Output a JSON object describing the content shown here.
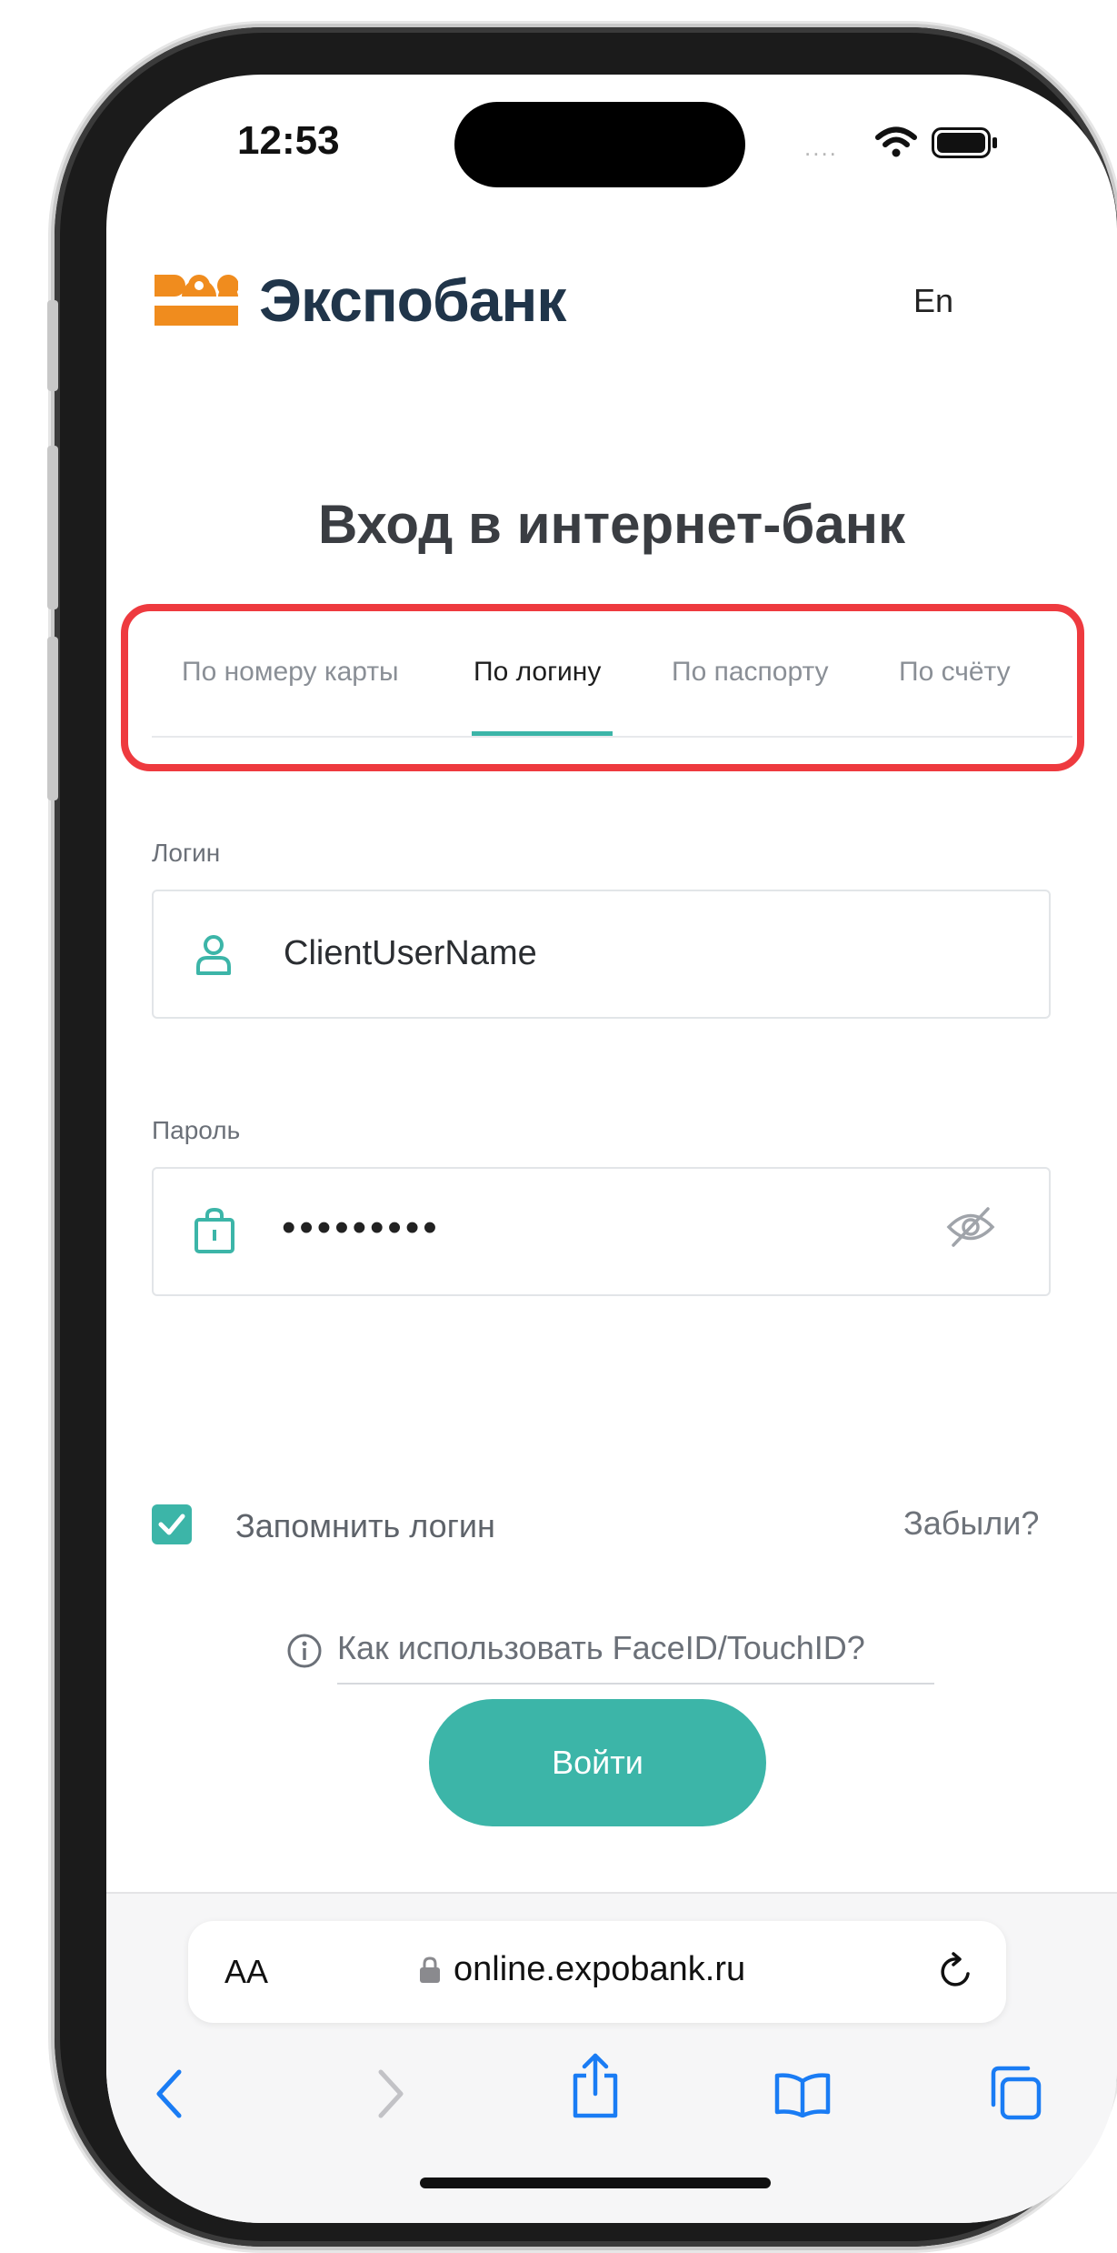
{
  "status_bar": {
    "time": "12:53",
    "signal_dots": "....",
    "icons": [
      "wifi-icon",
      "battery-icon"
    ]
  },
  "header": {
    "logo_text": "Экспобанк",
    "language": "En"
  },
  "title": "Вход в интернет-банк",
  "tabs": [
    {
      "label": "По номеру карты",
      "active": false
    },
    {
      "label": "По логину",
      "active": true
    },
    {
      "label": "По паспорту",
      "active": false
    },
    {
      "label": "По счёту",
      "active": false
    }
  ],
  "login_field": {
    "label": "Логин",
    "value": "ClientUserName",
    "icon": "user-icon"
  },
  "password_field": {
    "label": "Пароль",
    "value": "•••••••••",
    "icon": "lock-icon",
    "toggle_icon": "eye-off-icon"
  },
  "remember": {
    "label": "Запомнить логин",
    "checked": true
  },
  "forgot_link": "Забыли?",
  "face_id_help": "Как использовать FaceID/TouchID?",
  "login_button": "Войти",
  "browser": {
    "text_size": "AA",
    "url": "online.expobank.ru",
    "toolbar_icons": [
      "back-icon",
      "forward-icon",
      "share-icon",
      "bookmarks-icon",
      "tabs-icon"
    ]
  },
  "colors": {
    "accent": "#3cb5a8",
    "highlight": "#ee3a3f",
    "brand_orange": "#f08c1e",
    "brand_text": "#20354a"
  }
}
